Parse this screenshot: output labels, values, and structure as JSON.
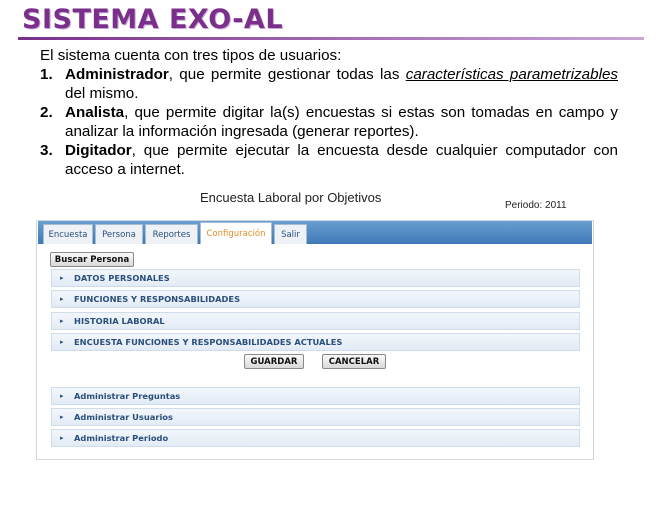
{
  "slide": {
    "title": "SISTEMA EXO-AL",
    "intro": "El sistema cuenta con tres tipos de usuarios:",
    "items": [
      {
        "num": "1.",
        "role": "Administrador",
        "pre": ", que permite gestionar todas las ",
        "em": "características parametrizables",
        "post": " del mismo."
      },
      {
        "num": "2.",
        "role": "Analista",
        "text": ", que permite digitar la(s) encuestas si estas son tomadas en campo y analizar la información ingresada (generar reportes)."
      },
      {
        "num": "3.",
        "role": "Digitador",
        "text": ", que permite ejecutar la encuesta desde cualquier computador con acceso a internet."
      }
    ]
  },
  "screenshot": {
    "title": "Encuesta Laboral por Objetivos",
    "periodo": "Periodo: 2011",
    "tabs": [
      "Encuesta",
      "Persona",
      "Reportes",
      "Configuración",
      "Salir"
    ],
    "active_tab": "Configuración",
    "buscar_label": "Buscar Persona",
    "sections": [
      "DATOS PERSONALES",
      "FUNCIONES Y RESPONSABILIDADES",
      "HISTORIA LABORAL",
      "ENCUESTA FUNCIONES Y RESPONSABILIDADES ACTUALES"
    ],
    "guardar_label": "GUARDAR",
    "cancelar_label": "CANCELAR",
    "admin_sections": [
      "Administrar Preguntas",
      "Administrar Usuarios",
      "Administrar Periodo"
    ]
  }
}
